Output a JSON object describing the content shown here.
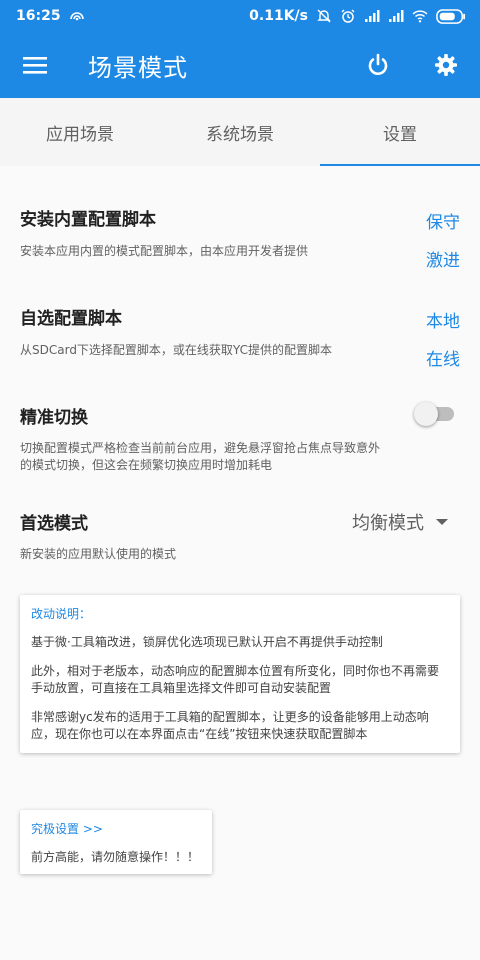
{
  "status": {
    "time": "16:25",
    "speed": "0.11K/s"
  },
  "toolbar": {
    "title": "场景模式",
    "menu_icon": "menu-icon",
    "power_icon": "power-icon",
    "settings_icon": "gear-icon"
  },
  "tabs": [
    {
      "label": "应用场景",
      "active": false
    },
    {
      "label": "系统场景",
      "active": false
    },
    {
      "label": "设置",
      "active": true
    }
  ],
  "settings": {
    "builtin": {
      "title": "安装内置配置脚本",
      "desc": "安装本应用内置的模式配置脚本，由本应用开发者提供",
      "option1": "保守",
      "option2": "激进"
    },
    "custom": {
      "title": "自选配置脚本",
      "desc": "从SDCard下选择配置脚本，或在线获取YC提供的配置脚本",
      "option1": "本地",
      "option2": "在线"
    },
    "precise": {
      "title": "精准切换",
      "desc": "切换配置模式严格检查当前前台应用，避免悬浮窗抢占焦点导致意外的模式切换，但这会在频繁切换应用时增加耗电",
      "enabled": false
    },
    "preferred": {
      "title": "首选模式",
      "desc": "新安装的应用默认使用的模式",
      "value": "均衡模式"
    }
  },
  "changelog": {
    "title": "改动说明：",
    "p1": "基于微·工具箱改进，锁屏优化选项现已默认开启不再提供手动控制",
    "p2": "此外，相对于老版本，动态响应的配置脚本位置有所变化，同时你也不再需要手动放置，可直接在工具箱里选择文件即可自动安装配置",
    "p3": "非常感谢yc发布的适用于工具箱的配置脚本，让更多的设备能够用上动态响应，现在你也可以在本界面点击“在线”按钮来快速获取配置脚本"
  },
  "advanced": {
    "title": "究极设置 >>",
    "desc": "前方高能，请勿随意操作！！！"
  },
  "colors": {
    "primary": "#1e88e5",
    "background": "#fafafa"
  }
}
